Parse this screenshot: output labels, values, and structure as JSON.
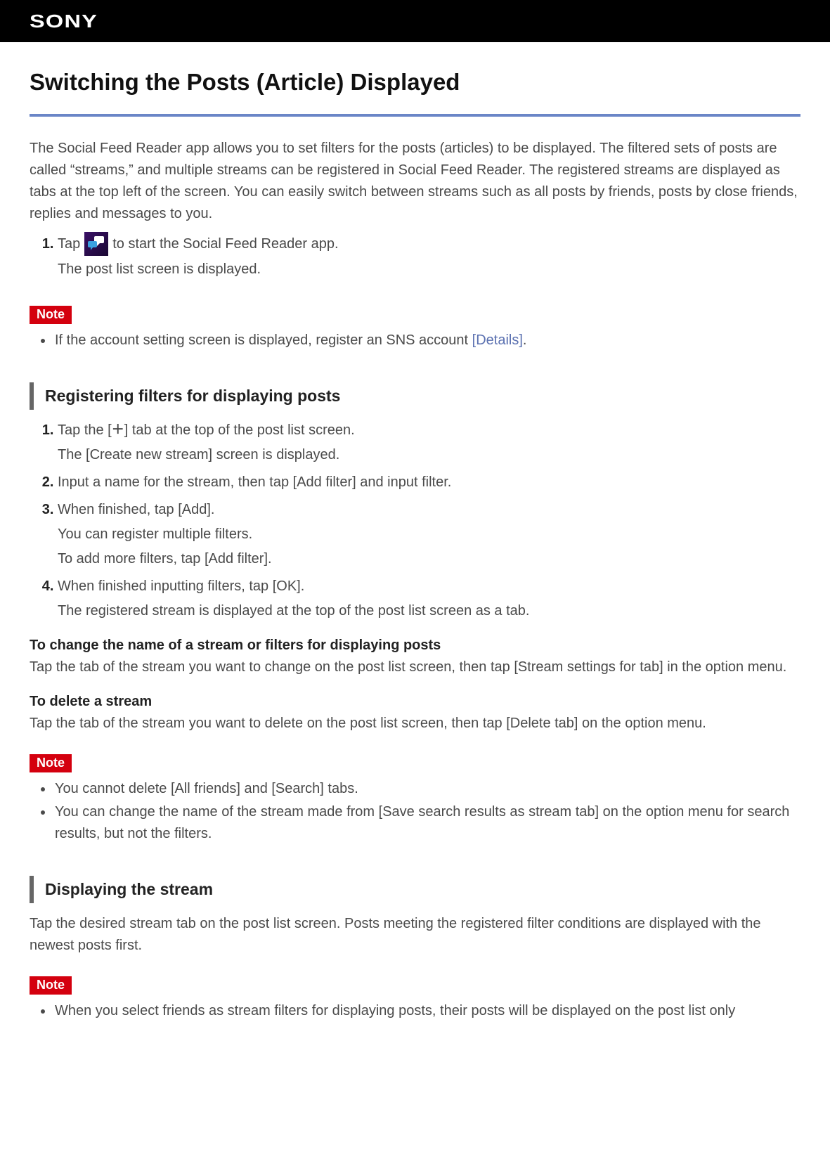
{
  "brand": "SONY",
  "title": "Switching the Posts (Article) Displayed",
  "intro": "The Social Feed Reader app allows you to set filters for the posts (articles) to be displayed. The filtered sets of posts are called “streams,” and multiple streams can be registered in Social Feed Reader. The registered streams are displayed as tabs at the top left of the screen. You can easily switch between streams such as all posts by friends, posts by close friends, replies and messages to you.",
  "step1_a": "Tap",
  "step1_b": "to start the Social Feed Reader app.",
  "step1_sub": "The post list screen is displayed.",
  "note_label": "Note",
  "note1_text": "If the account setting screen is displayed, register an SNS account ",
  "details_link": "[Details]",
  "note1_tail": ".",
  "section1": "Registering filters for displaying posts",
  "reg_steps": {
    "s1_a": "Tap the [",
    "s1_b": "] tab at the top of the post list screen.",
    "s1_sub": "The [Create new stream] screen is displayed.",
    "s2": "Input a name for the stream, then tap [Add filter] and input filter.",
    "s3": "When finished, tap [Add].",
    "s3_sub1": "You can register multiple filters.",
    "s3_sub2": "To add more filters, tap [Add filter].",
    "s4": "When finished inputting filters, tap [OK].",
    "s4_sub": "The registered stream is displayed at the top of the post list screen as a tab."
  },
  "sub1_h": "To change the name of a stream or filters for displaying posts",
  "sub1_p": "Tap the tab of the stream you want to change on the post list screen, then tap [Stream settings for tab] in the option menu.",
  "sub2_h": "To delete a stream",
  "sub2_p": "Tap the tab of the stream you want to delete on the post list screen, then tap [Delete tab] on the option menu.",
  "note2_items": [
    "You cannot delete [All friends] and [Search] tabs.",
    "You can change the name of the stream made from [Save search results as stream tab] on the option menu for search results, but not the filters."
  ],
  "section2": "Displaying the stream",
  "section2_p": "Tap the desired stream tab on the post list screen. Posts meeting the registered filter conditions are displayed with the newest posts first.",
  "note3_item": "When you select friends as stream filters for displaying posts, their posts will be displayed on the post list only"
}
